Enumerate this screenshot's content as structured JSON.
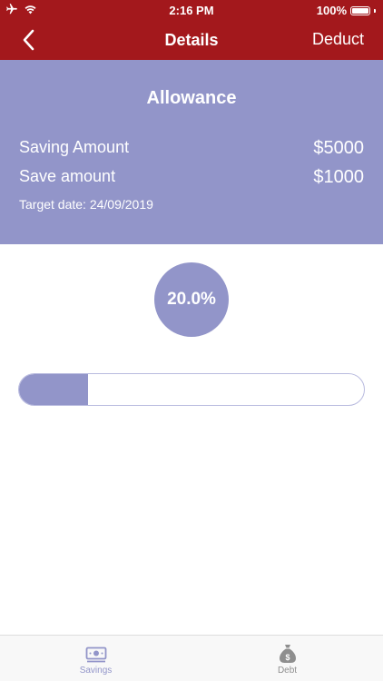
{
  "status": {
    "time": "2:16 PM",
    "battery": "100%"
  },
  "nav": {
    "title": "Details",
    "action": "Deduct"
  },
  "summary": {
    "title": "Allowance",
    "saving_label": "Saving Amount",
    "saving_value": "$5000",
    "save_label": "Save amount",
    "save_value": "$1000",
    "target": "Target date: 24/09/2019"
  },
  "progress": {
    "percent_text": "20.0%",
    "fraction": 0.2
  },
  "tabs": [
    {
      "label": "Savings",
      "icon": "money-icon",
      "active": true
    },
    {
      "label": "Debt",
      "icon": "money-bag-icon",
      "active": false
    }
  ],
  "colors": {
    "header": "#a3181c",
    "accent": "#9295c9"
  }
}
